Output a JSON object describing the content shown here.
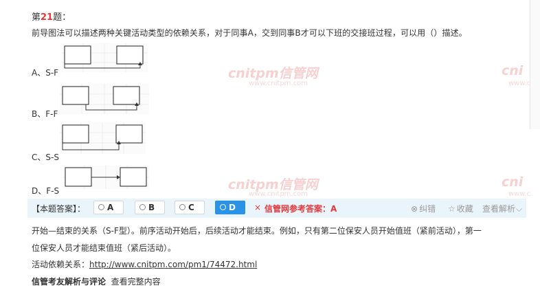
{
  "question": {
    "prefix": "第",
    "number": "21",
    "suffix": "题：",
    "text": "前导图法可以描述两种关键活动类型的依赖关系，对于同事A，交到同事B才可以下班的交接班过程，可以用（）描述。"
  },
  "options": [
    {
      "label": "A、S-F"
    },
    {
      "label": "B、F-F"
    },
    {
      "label": "C、S-S"
    },
    {
      "label": "D、F-S"
    }
  ],
  "watermark": {
    "logo": "cnitpm信管网",
    "logo_right": "cni",
    "url": "www.cnitpm.com",
    "url_right": "www.c"
  },
  "answer_bar": {
    "title": "【本题答案】：",
    "choices": [
      "A",
      "B",
      "C",
      "D"
    ],
    "selected": "D",
    "wrong_mark": "×",
    "reference_label": "信管网参考答案：",
    "reference_value": "A",
    "tools": {
      "report": "纠错",
      "favorite": "收藏",
      "view_analysis": "查看解析"
    }
  },
  "explanation": {
    "line1": "开始—结束的关系（S-F型）。前序活动开始后，后续活动才能结束。例如，只有第二位保安人员开始值班（紧前活动），第一",
    "line2": "位保安人员才能结束值班（紧后活动）。",
    "link_label": "活动依赖关系：",
    "link_url": "http://www.cnitpm.com/pm1/74472.html",
    "footer_title": "信管考友解析与评论",
    "footer_link": "查看完整内容"
  },
  "colors": {
    "accent_red": "#e4393c",
    "selected_blue": "#2a93e6",
    "bar_bg": "#eaf4fb"
  }
}
